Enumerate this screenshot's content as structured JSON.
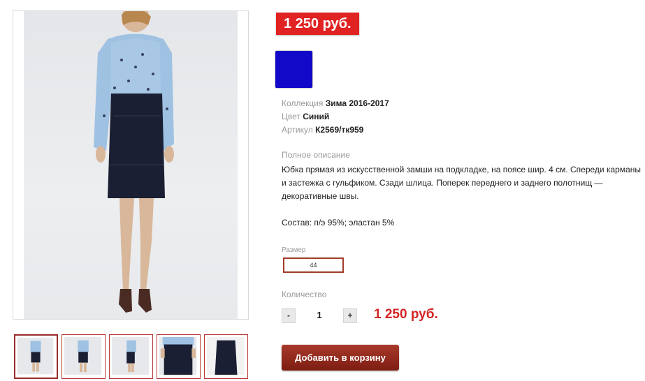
{
  "product": {
    "price_badge": "1 250 руб.",
    "color_swatch": "#1208c8",
    "attributes": [
      {
        "label": "Коллекция",
        "value": "Зима 2016-2017"
      },
      {
        "label": "Цвет",
        "value": "Синий"
      },
      {
        "label": "Артикул",
        "value": "К2569/тк959"
      }
    ],
    "description_title": "Полное описание",
    "description": "Юбка  прямая из искусственной замши на подкладке, на поясе шир. 4 см. Спереди карманы и застежка с гульфиком. Сзади  шлица. Поперек переднего и заднего полотнищ — декоративные швы.\n\nСостав: п/э 95%; эластан 5%",
    "size_title": "Размер",
    "size_value": "44",
    "quantity_title": "Количество",
    "quantity_minus": "-",
    "quantity_plus": "+",
    "quantity_value": "1",
    "total_price": "1 250 руб.",
    "add_to_cart": "Добавить в корзину"
  },
  "gallery": {
    "thumbnails": [
      "full-view",
      "full-view",
      "side-view",
      "close-up",
      "detail"
    ]
  },
  "colors": {
    "accent": "#e02222",
    "button": "#8b2a1c",
    "swatch": "#1208c8"
  }
}
